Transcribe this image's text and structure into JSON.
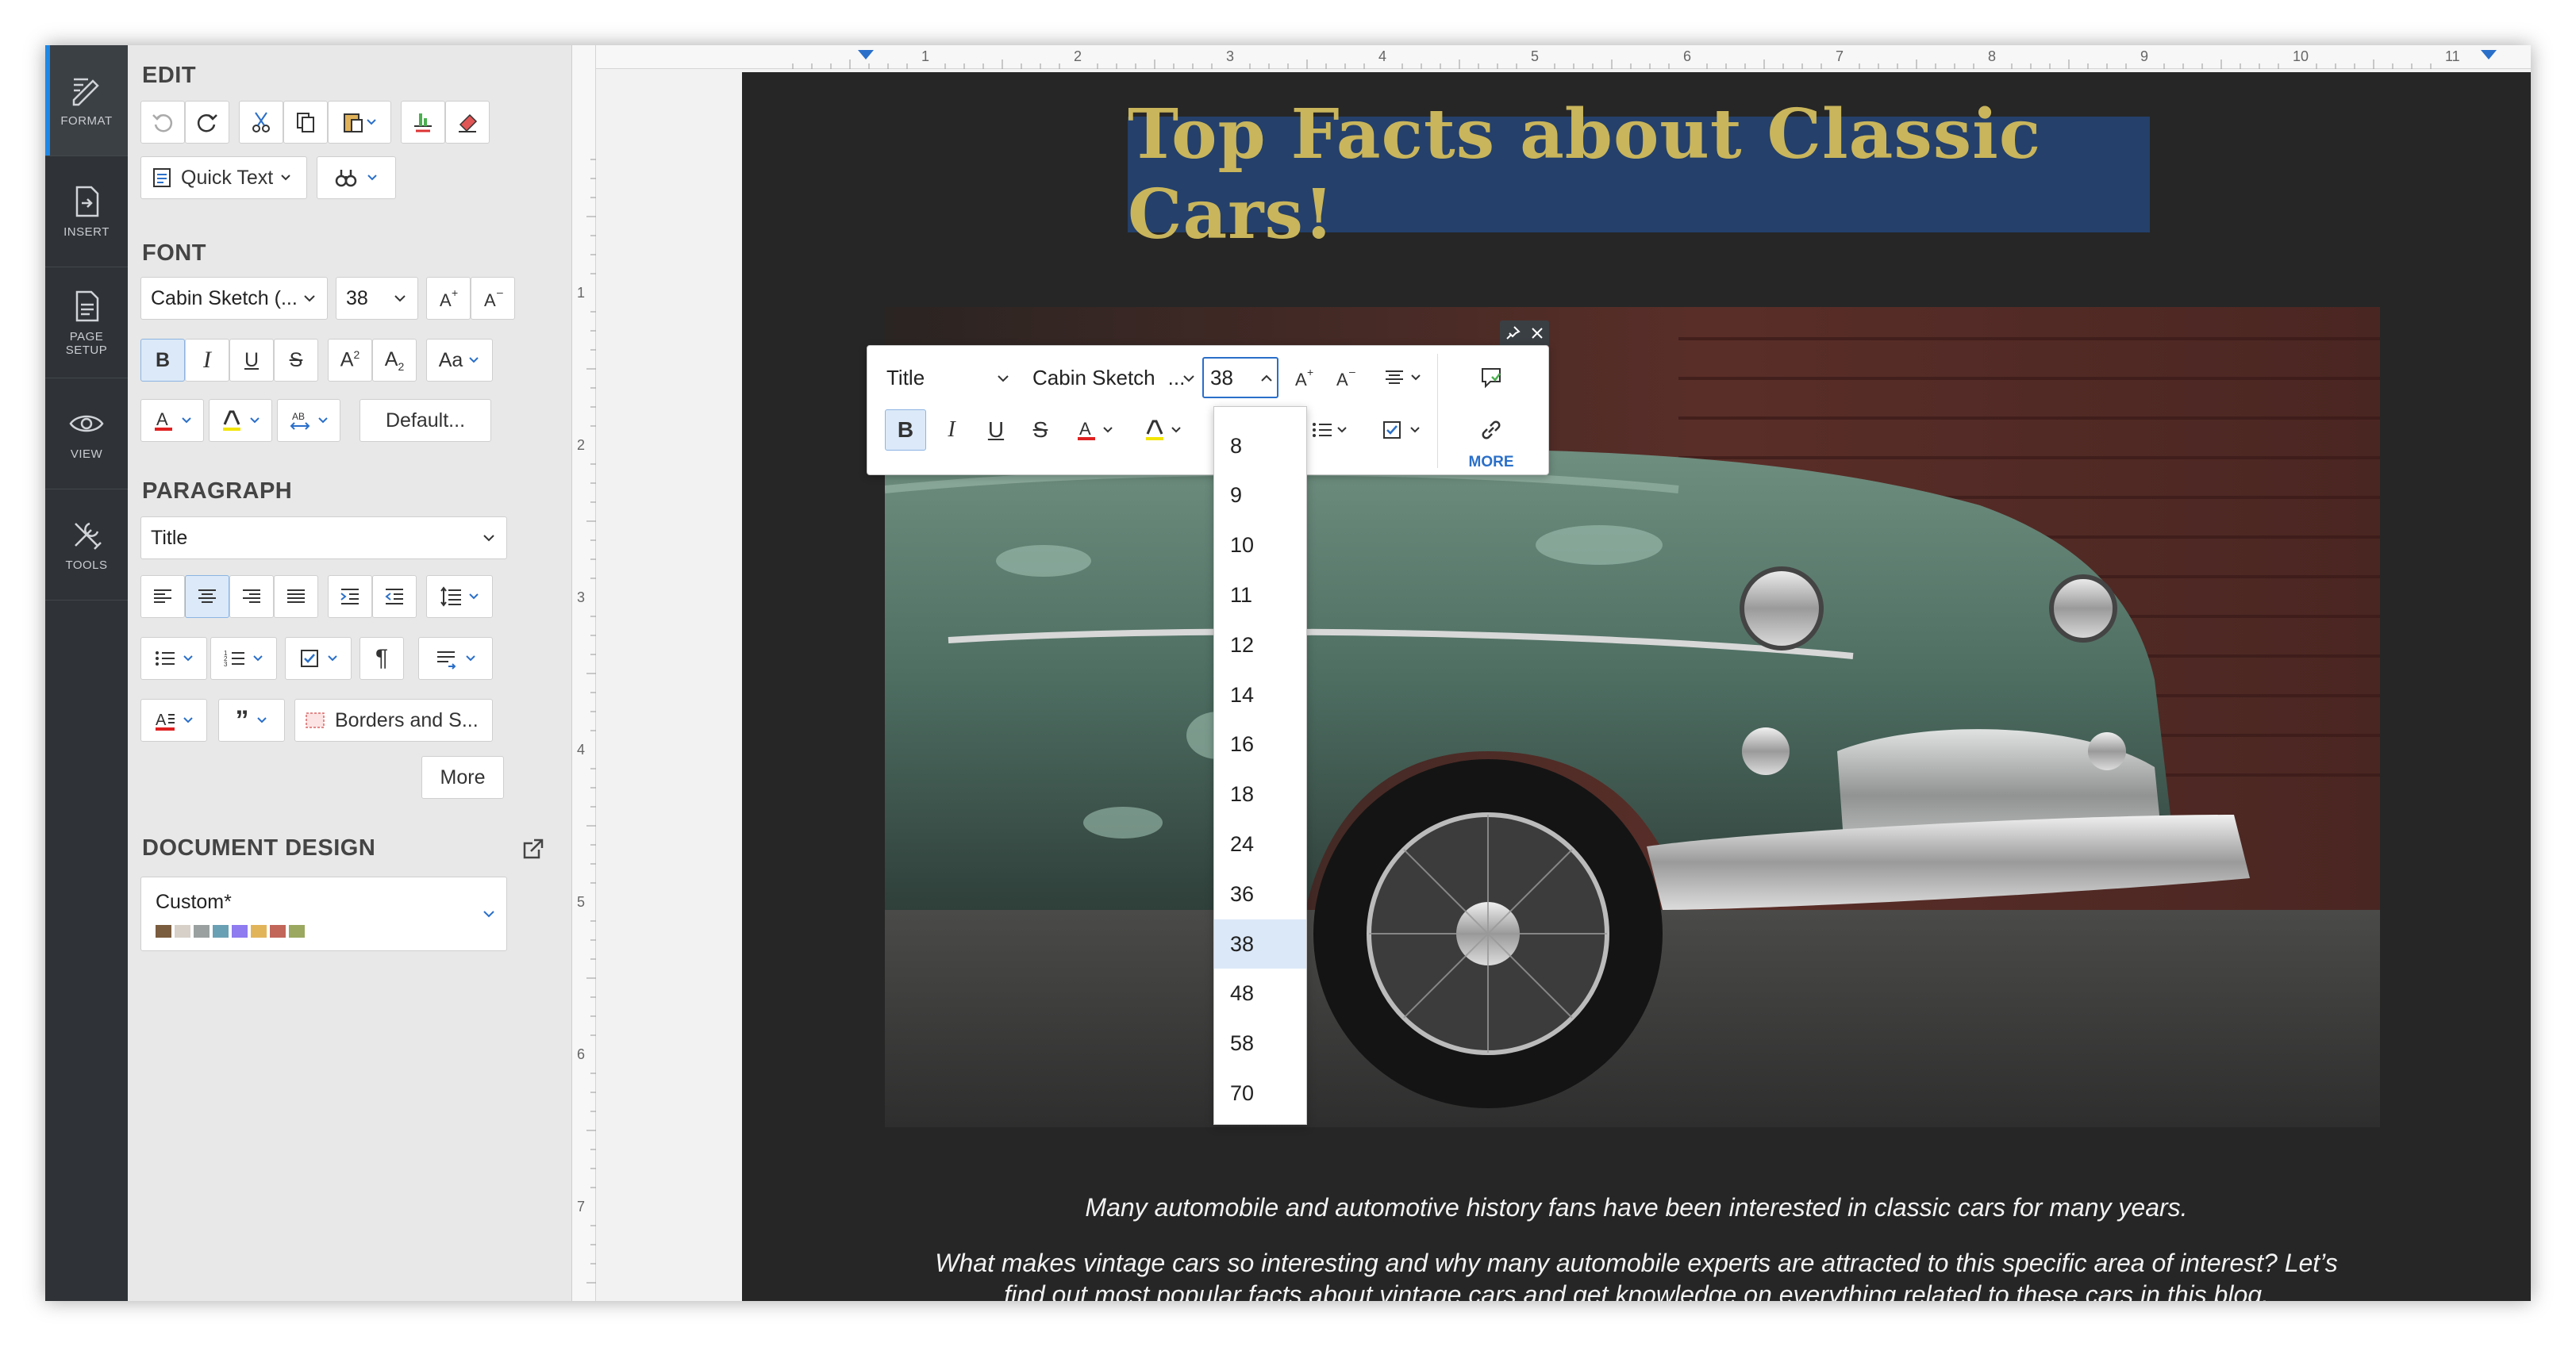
{
  "rail": {
    "items": [
      {
        "label": "FORMAT",
        "icon": "format-icon",
        "active": true
      },
      {
        "label": "INSERT",
        "icon": "insert-icon"
      },
      {
        "label": "PAGE SETUP",
        "icon": "page-setup-icon"
      },
      {
        "label": "VIEW",
        "icon": "eye-icon"
      },
      {
        "label": "TOOLS",
        "icon": "tools-icon"
      }
    ]
  },
  "panel": {
    "edit": {
      "title": "EDIT",
      "quick_text": "Quick Text"
    },
    "font": {
      "title": "FONT",
      "family": "Cabin Sketch (...",
      "size": "38",
      "default_label": "Default..."
    },
    "paragraph": {
      "title": "PARAGRAPH",
      "style": "Title",
      "borders_label": "Borders and S...",
      "more_label": "More"
    },
    "design": {
      "title": "DOCUMENT DESIGN",
      "theme": "Custom*",
      "swatches": [
        "#7a5c3e",
        "#d6d0c8",
        "#9aa0a0",
        "#6aa0b4",
        "#8e7cf0",
        "#e2b45a",
        "#c2665a",
        "#9aa860"
      ]
    }
  },
  "ruler": {
    "numbers": [
      "1",
      "2",
      "3",
      "4",
      "5",
      "6",
      "7",
      "8",
      "9",
      "10",
      "11"
    ],
    "vnumbers": [
      "1",
      "2",
      "3",
      "4",
      "5",
      "6",
      "7"
    ]
  },
  "document": {
    "title": "Top Facts about Classic Cars!",
    "para1": "Many automobile and automotive history fans have been interested in classic cars for many years.",
    "para2a": "What makes vintage cars so interesting and why many automobile experts are attracted to this specific area of interest? Let’s",
    "para2b": "find out most popular facts about vintage cars and get knowledge on everything related to these cars in this blog."
  },
  "floating_toolbar": {
    "style": "Title",
    "font": "Cabin Sketch",
    "font_ellipsis": "...",
    "size": "38",
    "more_label": "MORE"
  },
  "size_options": [
    "8",
    "9",
    "10",
    "11",
    "12",
    "14",
    "16",
    "18",
    "24",
    "36",
    "38",
    "48",
    "58",
    "70"
  ],
  "selected_size": "38",
  "colors": {
    "accent": "#1e88e5",
    "title_bg": "#24406b",
    "title_text": "#c9b55b",
    "page_bg": "#262626"
  }
}
